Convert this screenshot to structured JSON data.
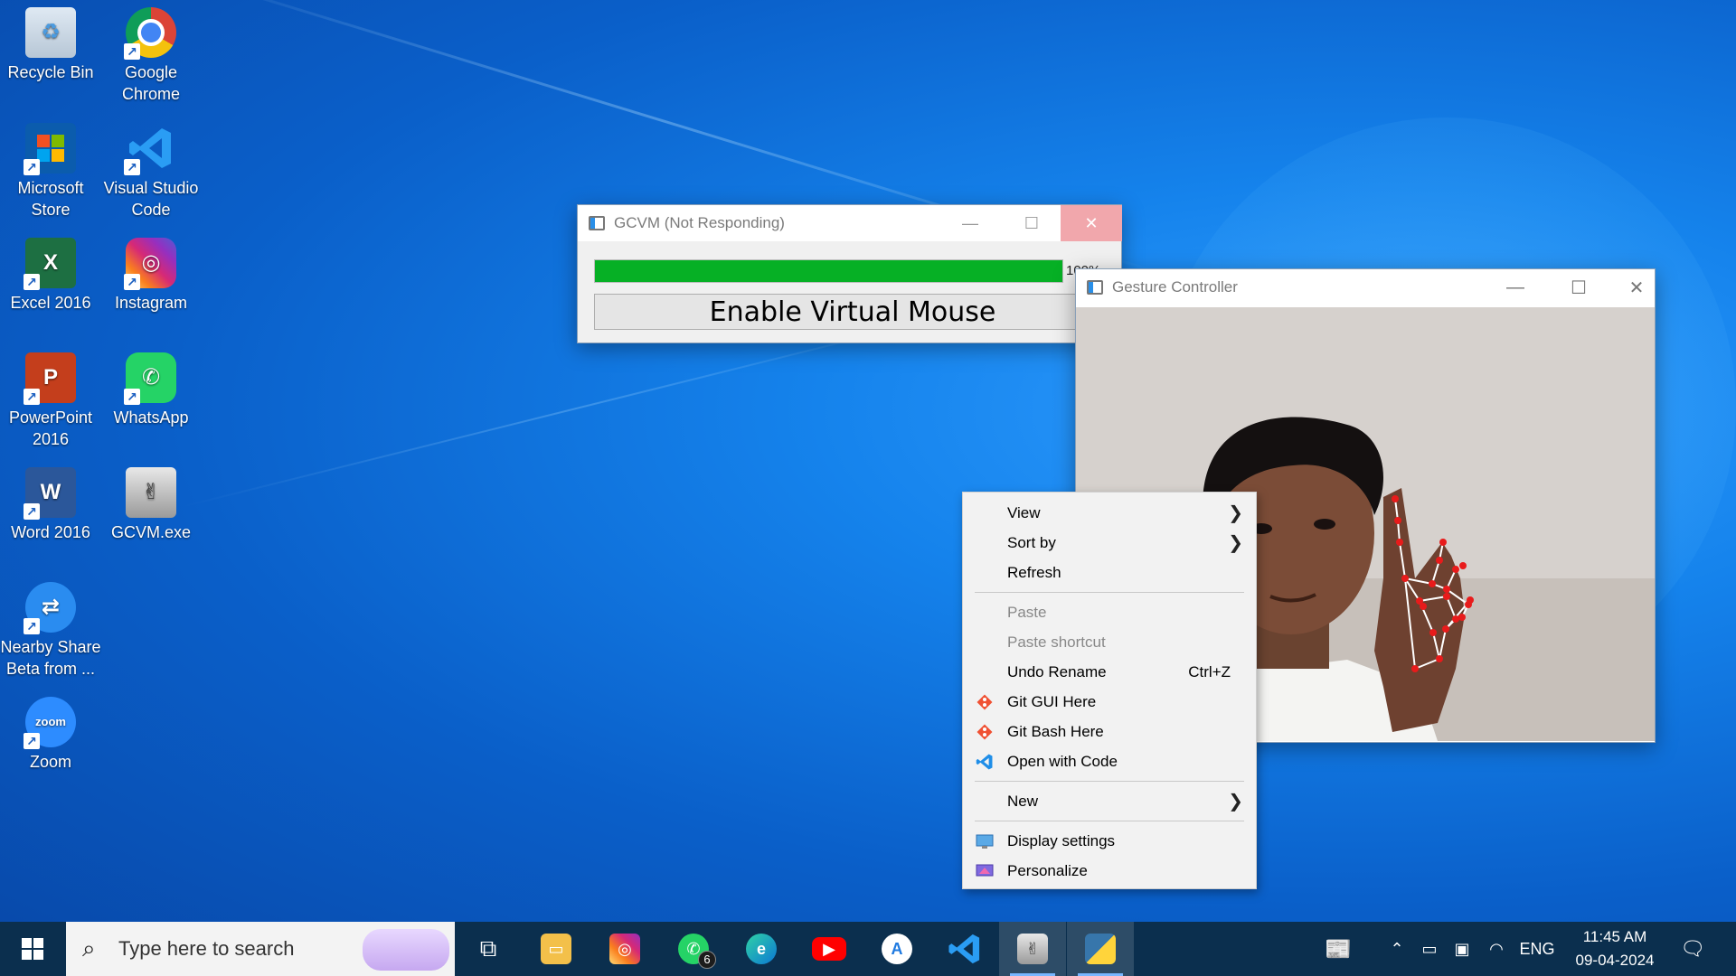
{
  "desktop": {
    "icons": [
      {
        "label": "Recycle Bin",
        "icon": "recycle-bin-icon"
      },
      {
        "label": "Google Chrome",
        "icon": "chrome-icon"
      },
      {
        "label": "Microsoft Store",
        "icon": "microsoft-store-icon"
      },
      {
        "label": "Visual Studio Code",
        "icon": "vscode-icon"
      },
      {
        "label": "Excel 2016",
        "icon": "excel-icon"
      },
      {
        "label": "Instagram",
        "icon": "instagram-icon"
      },
      {
        "label": "PowerPoint 2016",
        "icon": "powerpoint-icon"
      },
      {
        "label": "WhatsApp",
        "icon": "whatsapp-icon"
      },
      {
        "label": "Word 2016",
        "icon": "word-icon"
      },
      {
        "label": "GCVM.exe",
        "icon": "gcvm-icon"
      },
      {
        "label": "Nearby Share Beta from ...",
        "icon": "nearby-share-icon"
      },
      {
        "label": "Zoom",
        "icon": "zoom-icon",
        "glyph": "zoom"
      }
    ]
  },
  "gcvm_window": {
    "title": "GCVM (Not Responding)",
    "progress_text": "100%",
    "progress": 1.0,
    "button_label": "Enable Virtual Mouse",
    "progress_color": "#06b025"
  },
  "gesture_window": {
    "title": "Gesture Controller"
  },
  "context_menu": {
    "items": [
      {
        "label": "View",
        "submenu": true
      },
      {
        "label": "Sort by",
        "submenu": true
      },
      {
        "label": "Refresh"
      },
      {
        "label": "Paste",
        "disabled": true
      },
      {
        "label": "Paste shortcut",
        "disabled": true
      },
      {
        "label": "Undo Rename",
        "shortcut": "Ctrl+Z"
      },
      {
        "label": "Git GUI Here",
        "icon": "git-icon"
      },
      {
        "label": "Git Bash Here",
        "icon": "git-icon"
      },
      {
        "label": "Open with Code",
        "icon": "vscode-icon"
      },
      {
        "label": "New",
        "submenu": true
      },
      {
        "label": "Display settings",
        "icon": "display-icon"
      },
      {
        "label": "Personalize",
        "icon": "personalize-icon"
      }
    ]
  },
  "taskbar": {
    "search_placeholder": "Type here to search",
    "whatsapp_badge": "6",
    "language": "ENG",
    "time": "11:45 AM",
    "date": "09-04-2024",
    "apps": [
      "task-view-icon",
      "file-explorer-icon",
      "instagram-icon",
      "whatsapp-icon",
      "edge-icon",
      "youtube-icon",
      "app-store-icon",
      "vscode-icon",
      "gcvm-icon",
      "python-icon"
    ]
  }
}
